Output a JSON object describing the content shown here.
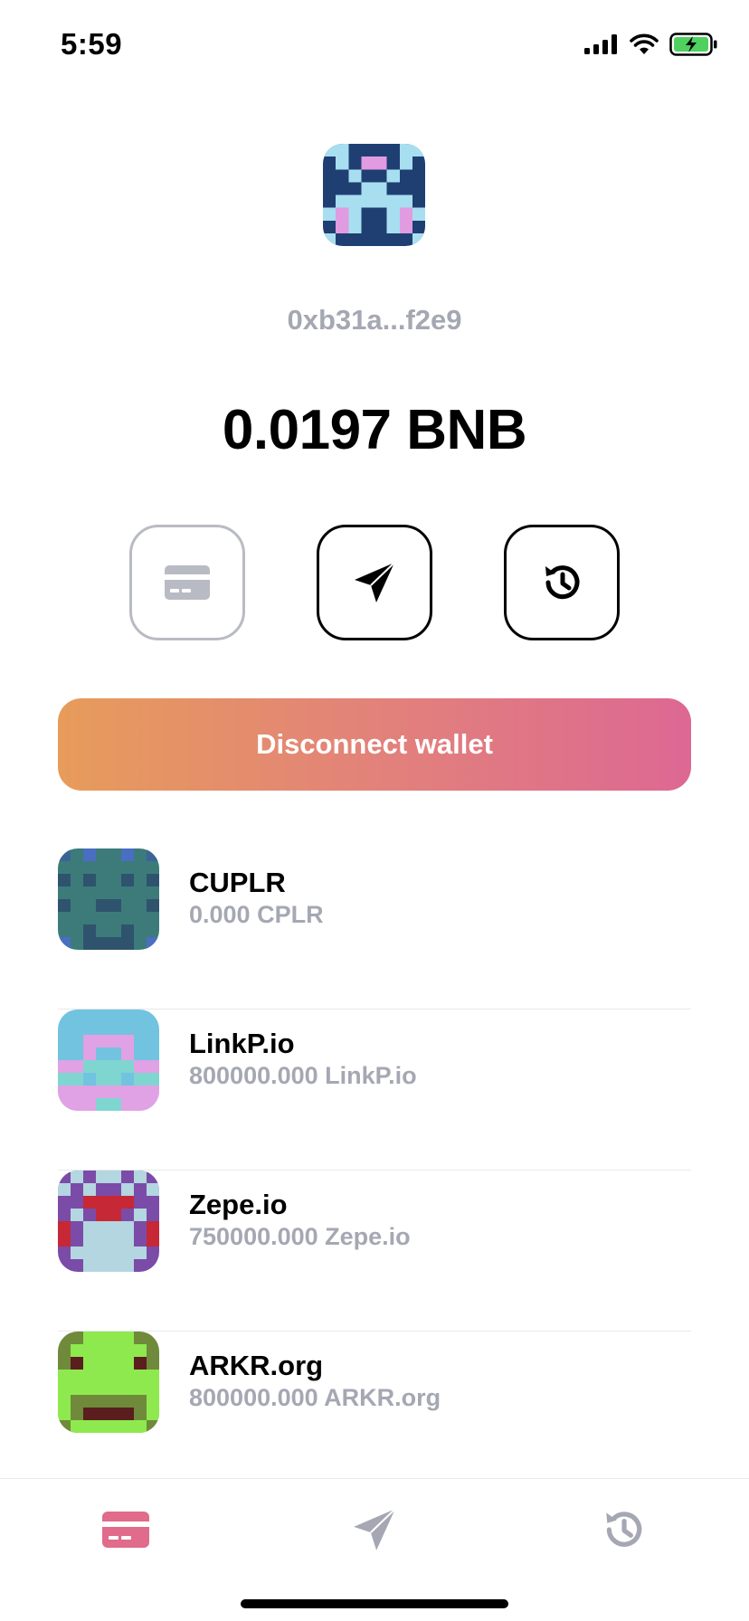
{
  "status_bar": {
    "time": "5:59"
  },
  "wallet": {
    "address": "0xb31a...f2e9",
    "balance": "0.0197 BNB"
  },
  "actions": {
    "buy_icon": "credit-card-icon",
    "send_icon": "paper-plane-icon",
    "history_icon": "history-clock-icon"
  },
  "disconnect": {
    "label": "Disconnect wallet"
  },
  "tokens": [
    {
      "name": "CUPLR",
      "balance": "0.000 CPLR"
    },
    {
      "name": "LinkP.io",
      "balance": "800000.000 LinkP.io"
    },
    {
      "name": "Zepe.io",
      "balance": "750000.000 Zepe.io"
    },
    {
      "name": "ARKR.org",
      "balance": "800000.000 ARKR.org"
    }
  ],
  "tabs": [
    {
      "icon": "credit-card-icon",
      "active": true
    },
    {
      "icon": "paper-plane-icon",
      "active": false
    },
    {
      "icon": "history-clock-icon",
      "active": false
    }
  ],
  "colors": {
    "accent_start": "#e79c5a",
    "accent_end": "#dd6893",
    "muted": "#a5a8b3",
    "tab_active": "#e06b8a"
  }
}
